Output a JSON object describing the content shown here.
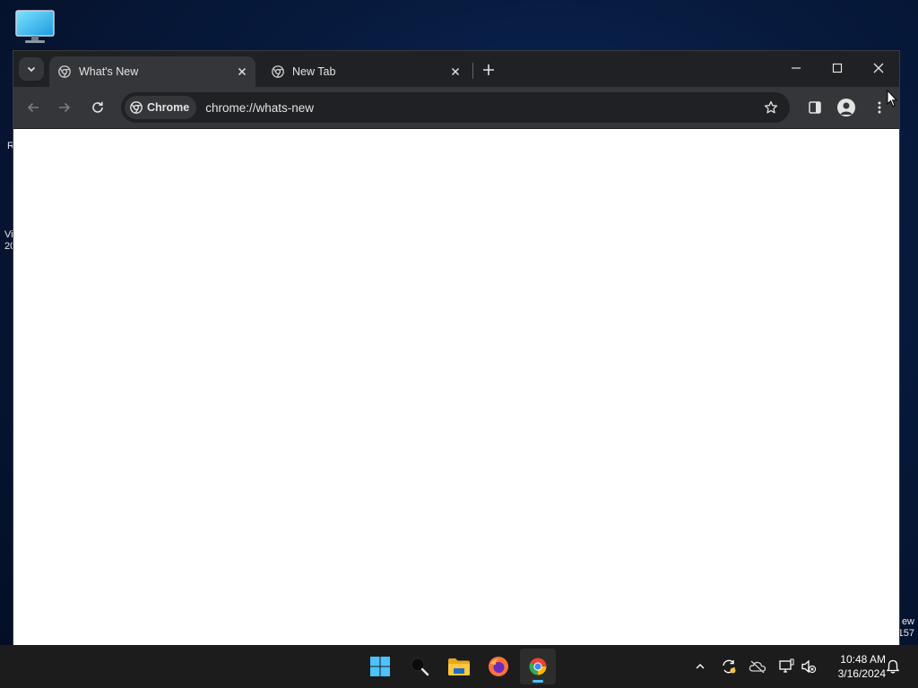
{
  "desktop": {
    "left_label_1": "R",
    "left_label_2": "Vi",
    "left_label_3": "20",
    "right_label_1": "ew",
    "right_label_2": "157"
  },
  "browser": {
    "tabs": [
      {
        "title": "What's New",
        "active": true
      },
      {
        "title": "New Tab",
        "active": false
      }
    ],
    "omnibox": {
      "chip_label": "Chrome",
      "url": "chrome://whats-new"
    }
  },
  "taskbar": {
    "apps": [
      "start",
      "search",
      "file-explorer",
      "firefox",
      "chrome"
    ],
    "clock_time": "10:48 AM",
    "clock_date": "3/16/2024"
  },
  "colors": {
    "tabstrip": "#202124",
    "toolbar": "#35363a",
    "accent": "#4cc2ff"
  }
}
